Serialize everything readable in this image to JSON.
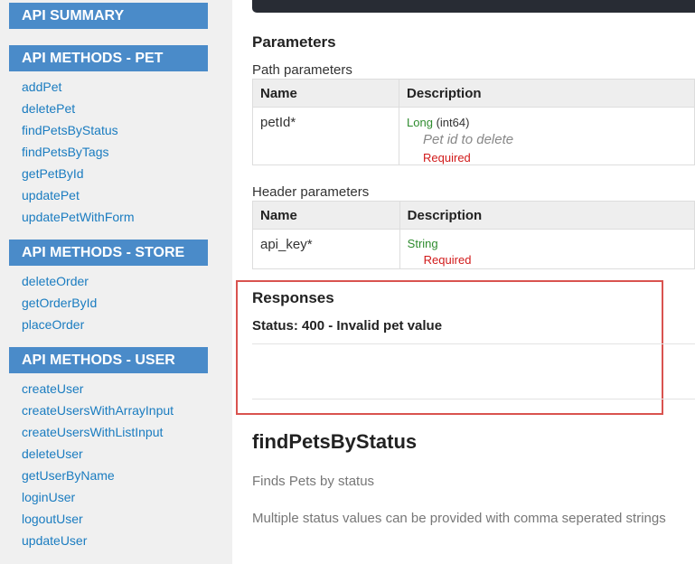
{
  "sidebar": {
    "summary_header": "API SUMMARY",
    "pet_header": "API METHODS - PET",
    "pet_items": [
      "addPet",
      "deletePet",
      "findPetsByStatus",
      "findPetsByTags",
      "getPetById",
      "updatePet",
      "updatePetWithForm"
    ],
    "store_header": "API METHODS - STORE",
    "store_items": [
      "deleteOrder",
      "getOrderById",
      "placeOrder"
    ],
    "user_header": "API METHODS - USER",
    "user_items": [
      "createUser",
      "createUsersWithArrayInput",
      "createUsersWithListInput",
      "deleteUser",
      "getUserByName",
      "loginUser",
      "logoutUser",
      "updateUser"
    ]
  },
  "main": {
    "parameters_title": "Parameters",
    "path_params": {
      "title": "Path parameters",
      "headers": [
        "Name",
        "Description"
      ],
      "row": {
        "name": "petId*",
        "type": "Long",
        "type_note": " (int64)",
        "description": "Pet id to delete",
        "required": "Required"
      }
    },
    "header_params": {
      "title": "Header parameters",
      "headers": [
        "Name",
        "Description"
      ],
      "row": {
        "name": "api_key*",
        "type": "String",
        "required": "Required"
      }
    },
    "responses_title": "Responses",
    "status_line": "Status: 400 - Invalid pet value",
    "next_method": {
      "title": "findPetsByStatus",
      "summary": "Finds Pets by status",
      "description": "Multiple status values can be provided with comma seperated strings"
    }
  }
}
